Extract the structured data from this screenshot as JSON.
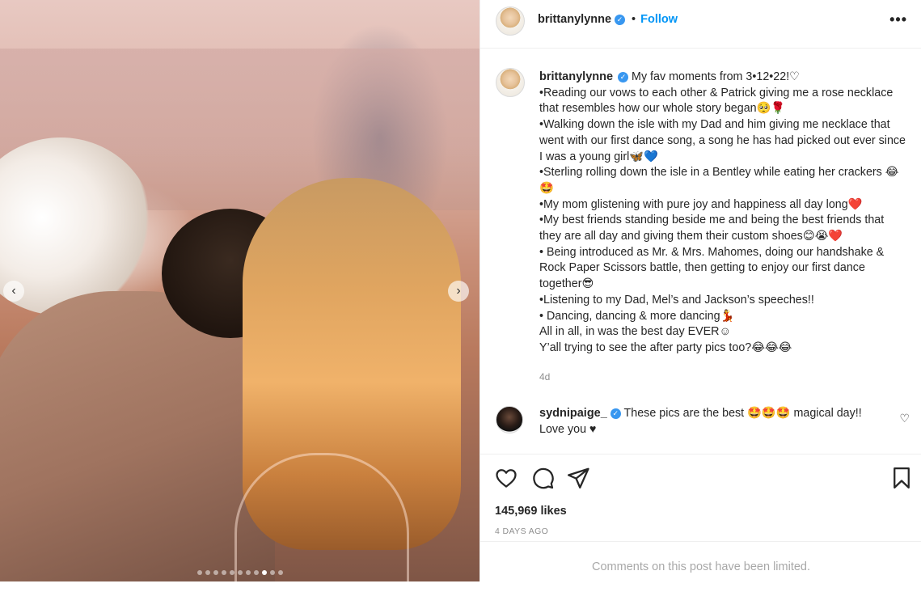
{
  "media": {
    "prev_glyph": "‹",
    "next_glyph": "›",
    "dots_total": 11,
    "dots_active_index": 8
  },
  "header": {
    "username": "brittanylynne",
    "verified_glyph": "✓",
    "separator": "•",
    "follow_label": "Follow",
    "more_glyph": "•••"
  },
  "caption": {
    "username": "brittanylynne",
    "text": "My fav moments from 3•12•22!♡\n•Reading our vows to each other & Patrick giving me a rose necklace that resembles how our whole story began🥺🌹\n•Walking down the isle with my Dad and him giving me necklace that went with our first dance song, a song he has had picked out ever since I was a young girl🦋💙\n•Sterling rolling down the isle in a Bentley while eating her crackers 😂🤩\n•My mom glistening with pure joy and happiness all day long❤️\n•My best friends standing beside me and being the best friends that they are all day and giving them their custom shoes😊😭❤️\n• Being introduced as Mr. & Mrs. Mahomes, doing our handshake & Rock Paper Scissors battle, then getting to enjoy our first dance together😎\n•Listening to my Dad, Mel’s and Jackson’s speeches!!\n• Dancing, dancing & more dancing💃\nAll in all, in was the best day EVER☺\nY’all trying to see the after party pics too?😂😂😂",
    "age": "4d"
  },
  "comment": {
    "username": "sydnipaige_",
    "text": "These pics are the best 🤩🤩🤩 magical day!!\nLove you ♥",
    "like_glyph": "♡"
  },
  "actions": {
    "likes": "145,969 likes",
    "date": "4 DAYS AGO"
  },
  "footer": {
    "notice": "Comments on this post have been limited."
  },
  "colors": {
    "link": "#0095f6",
    "verified": "#3897f0",
    "muted": "#8e8e8e"
  }
}
